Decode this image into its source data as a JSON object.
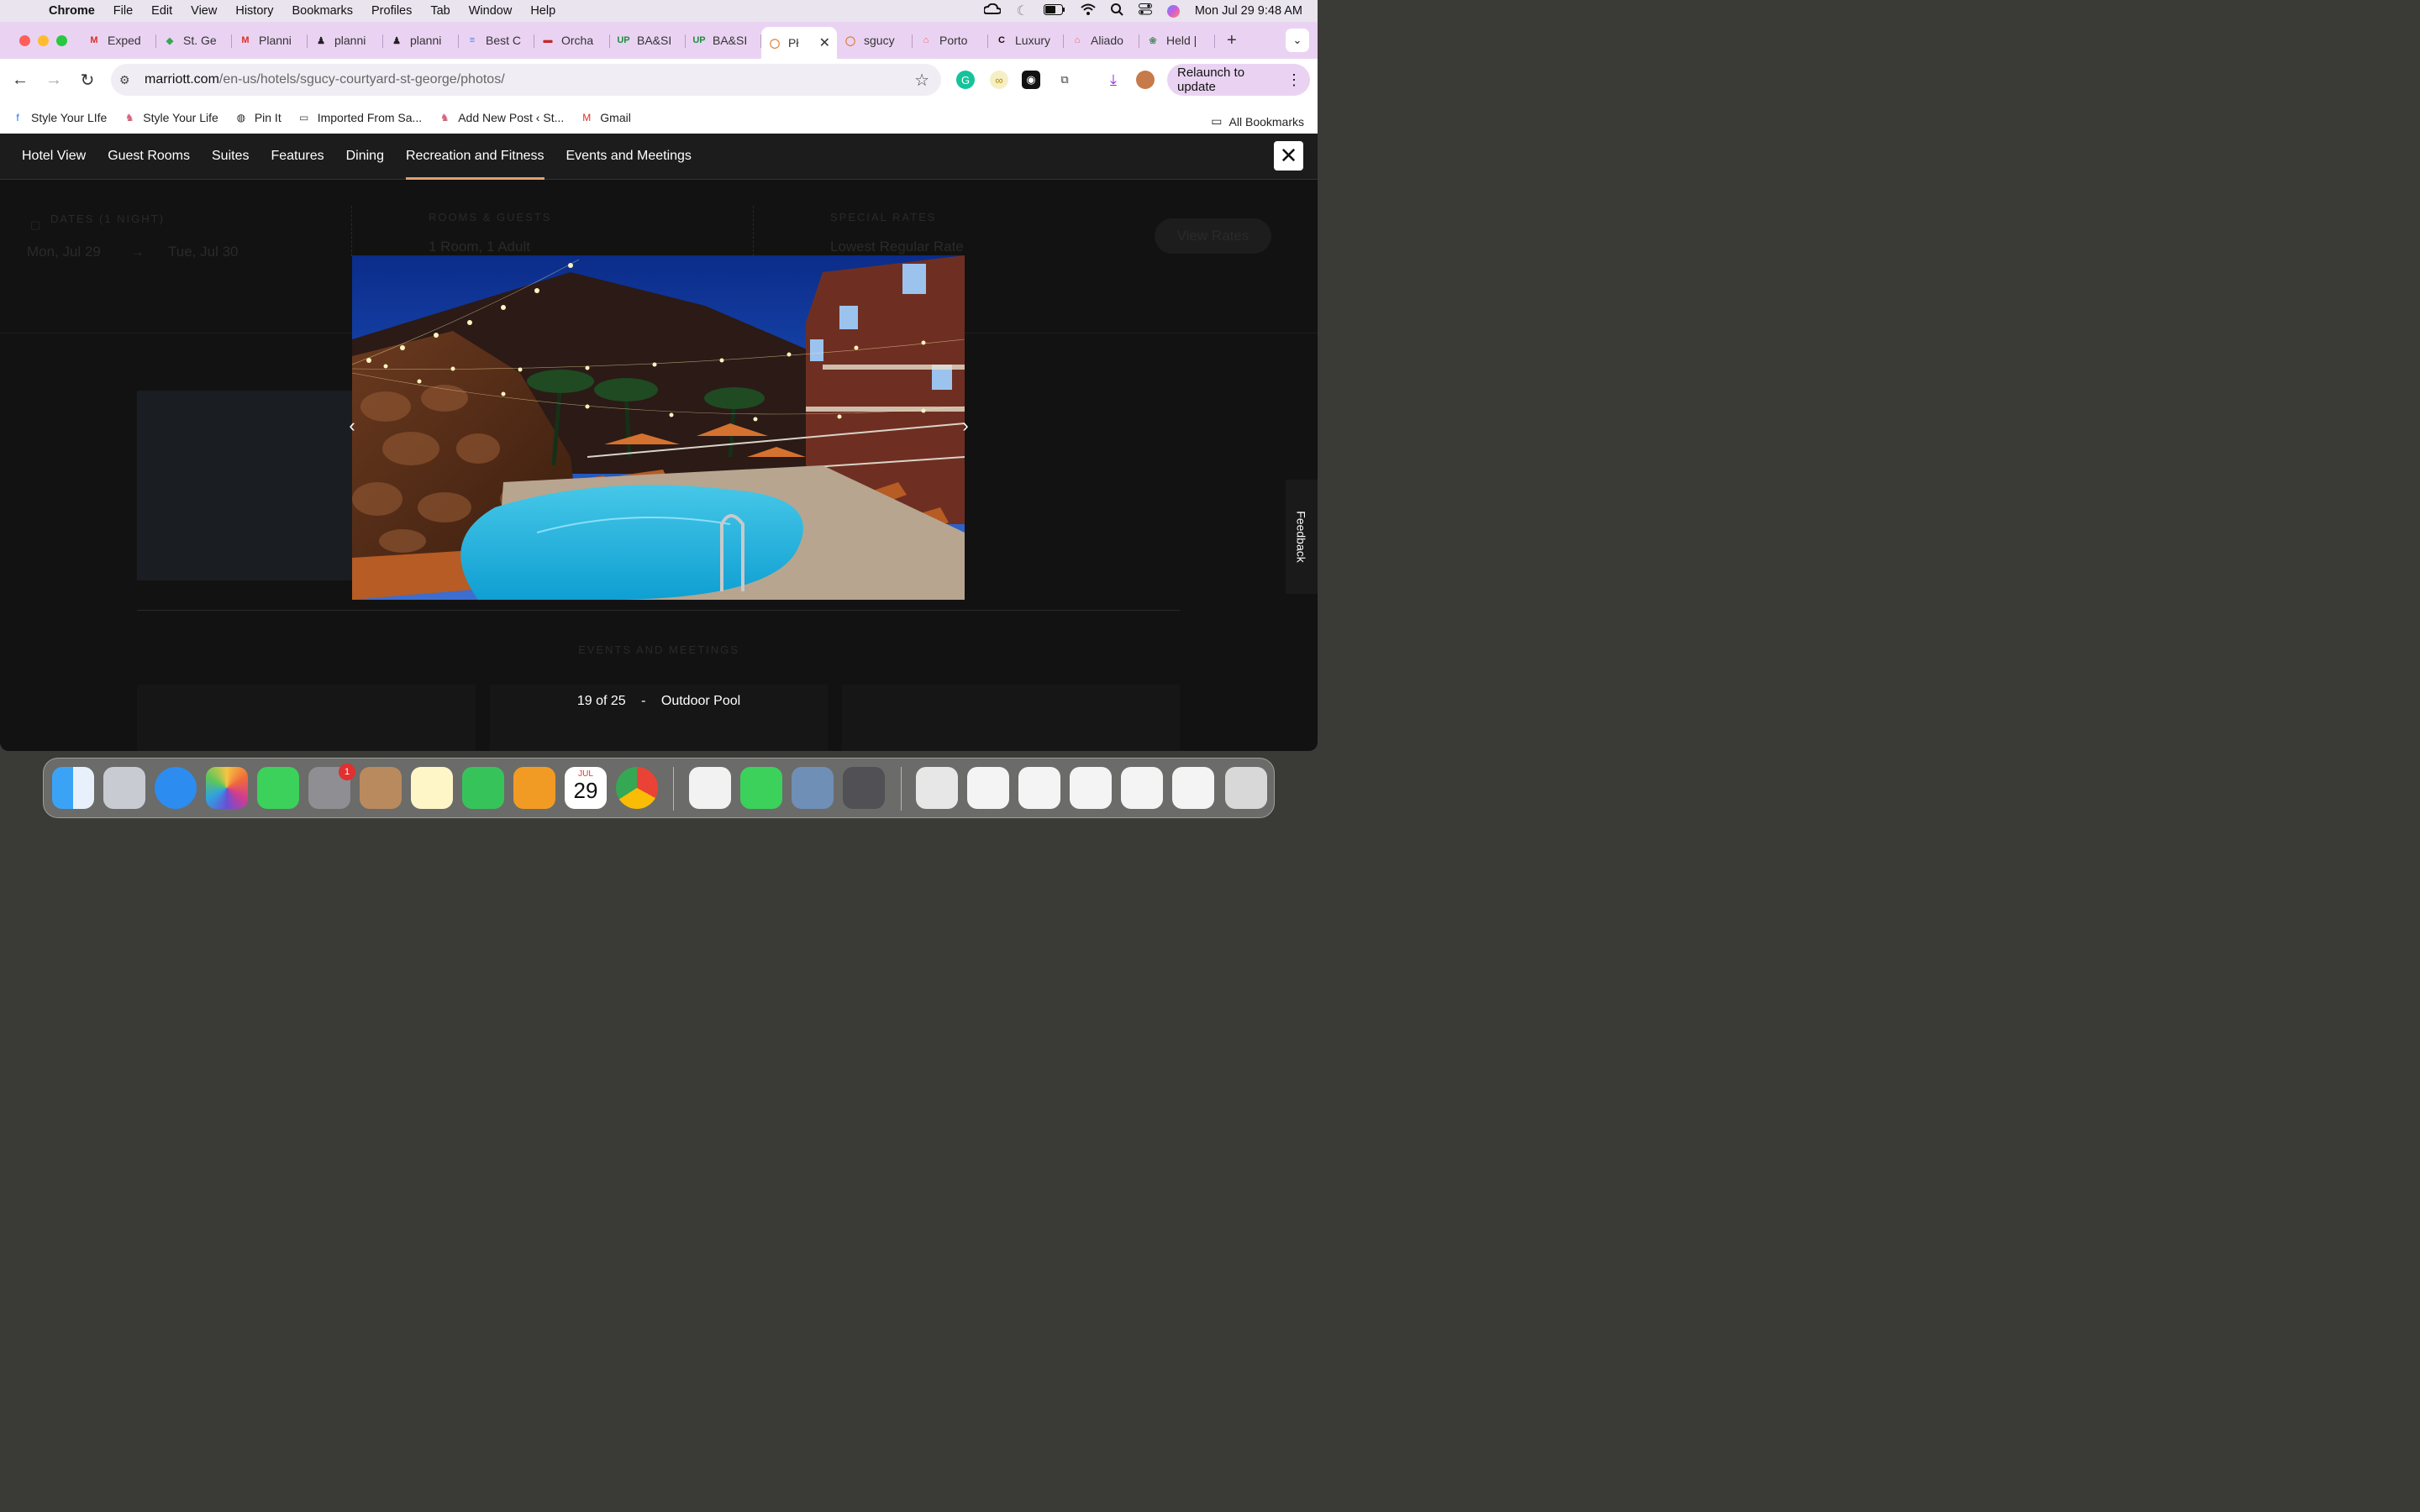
{
  "menubar": {
    "app": "Chrome",
    "items": [
      "File",
      "Edit",
      "View",
      "History",
      "Bookmarks",
      "Profiles",
      "Tab",
      "Window",
      "Help"
    ],
    "datetime": "Mon Jul 29  9:48 AM"
  },
  "tabs": [
    {
      "label": "Exped",
      "icon": "gmail-icon",
      "color": "#d93025",
      "glyph": "M"
    },
    {
      "label": "St. Ge",
      "icon": "maps-pin-icon",
      "color": "#34a853",
      "glyph": "◆"
    },
    {
      "label": "Planni",
      "icon": "gmail-icon",
      "color": "#d93025",
      "glyph": "M"
    },
    {
      "label": "planni",
      "icon": "person-icon",
      "color": "#222222",
      "glyph": "♟"
    },
    {
      "label": "planni",
      "icon": "person-icon",
      "color": "#222222",
      "glyph": "♟"
    },
    {
      "label": "Best C",
      "icon": "docs-icon",
      "color": "#4285f4",
      "glyph": "≡"
    },
    {
      "label": "Orcha",
      "icon": "flag-icon",
      "color": "#c62828",
      "glyph": "▬"
    },
    {
      "label": "BA&SI",
      "icon": "up-badge-icon",
      "color": "#1e8e3e",
      "glyph": "UP"
    },
    {
      "label": "BA&SI",
      "icon": "up-badge-icon",
      "color": "#1e8e3e",
      "glyph": "UP"
    },
    {
      "label": "Pł",
      "icon": "marriott-icon",
      "color": "#e07a2e",
      "glyph": "◯",
      "active": true
    },
    {
      "label": "sgucy",
      "icon": "marriott-icon",
      "color": "#e07a2e",
      "glyph": "◯"
    },
    {
      "label": "Porto",
      "icon": "airbnb-icon",
      "color": "#ff5a5f",
      "glyph": "⌂"
    },
    {
      "label": "Luxury",
      "icon": "c-logo-icon",
      "color": "#111111",
      "glyph": "C"
    },
    {
      "label": "Aliado",
      "icon": "airbnb-icon",
      "color": "#ff5a5f",
      "glyph": "⌂"
    },
    {
      "label": "Held |",
      "icon": "leaf-icon",
      "color": "#5a8f6a",
      "glyph": "❀"
    }
  ],
  "omnibox": {
    "domain": "marriott.com",
    "path": "/en-us/hotels/sgucy-courtyard-st-george/photos/"
  },
  "relaunch_label": "Relaunch to update",
  "bookmarks": [
    {
      "label": "Style Your LIfe",
      "icon": "facebook-icon",
      "color": "#1877f2",
      "glyph": "f"
    },
    {
      "label": "Style Your Life",
      "icon": "pig-icon",
      "color": "#d4607a",
      "glyph": "♞"
    },
    {
      "label": "Pin It",
      "icon": "globe-icon",
      "color": "#222222",
      "glyph": "◍"
    },
    {
      "label": "Imported From Sa...",
      "icon": "folder-icon",
      "color": "#444444",
      "glyph": "▭"
    },
    {
      "label": "Add New Post ‹ St...",
      "icon": "pig-icon",
      "color": "#d4607a",
      "glyph": "♞"
    },
    {
      "label": "Gmail",
      "icon": "gmail-icon",
      "color": "#d93025",
      "glyph": "M"
    }
  ],
  "all_bookmarks": "All Bookmarks",
  "photo_nav": {
    "items": [
      "Hotel View",
      "Guest Rooms",
      "Suites",
      "Features",
      "Dining",
      "Recreation and Fitness",
      "Events and Meetings"
    ],
    "active_index": 5
  },
  "background_page": {
    "dates_label": "DATES (1 NIGHT)",
    "checkin": "Mon, Jul 29",
    "checkout": "Tue, Jul 30",
    "rooms_label": "ROOMS & GUESTS",
    "rooms_value": "1 Room, 1 Adult",
    "rates_label": "SPECIAL RATES",
    "rates_value": "Lowest Regular Rate",
    "view_rates": "View Rates",
    "section_heading": "EVENTS AND MEETINGS"
  },
  "lightbox": {
    "counter": "19 of 25",
    "separator": "-",
    "caption": "Outdoor Pool"
  },
  "feedback_label": "Feedback",
  "dock": {
    "calendar_month": "JUL",
    "calendar_day": "29",
    "settings_badge": "1"
  }
}
